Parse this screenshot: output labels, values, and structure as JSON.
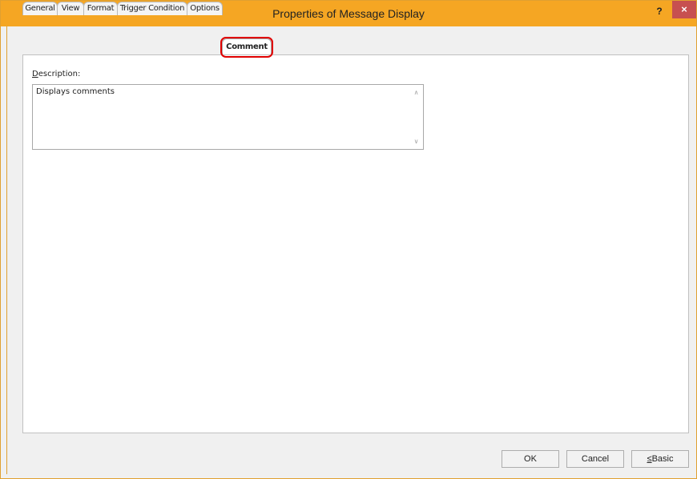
{
  "window": {
    "title": "Properties of Message Display",
    "help_label": "?",
    "close_label": "×"
  },
  "tabs": [
    {
      "label": "General"
    },
    {
      "label": "View"
    },
    {
      "label": "Format"
    },
    {
      "label": "Trigger Condition"
    },
    {
      "label": "Options"
    },
    {
      "label": "Comment",
      "active": true
    }
  ],
  "comment_tab": {
    "description_label_accel": "D",
    "description_label_rest": "escription:",
    "description_value": "Displays comments"
  },
  "buttons": {
    "ok": "OK",
    "cancel": "Cancel",
    "basic_accel": "≤",
    "basic_rest": "Basic"
  },
  "colors": {
    "titlebar": "#f5a623",
    "close": "#c75050",
    "highlight": "#e00000"
  }
}
